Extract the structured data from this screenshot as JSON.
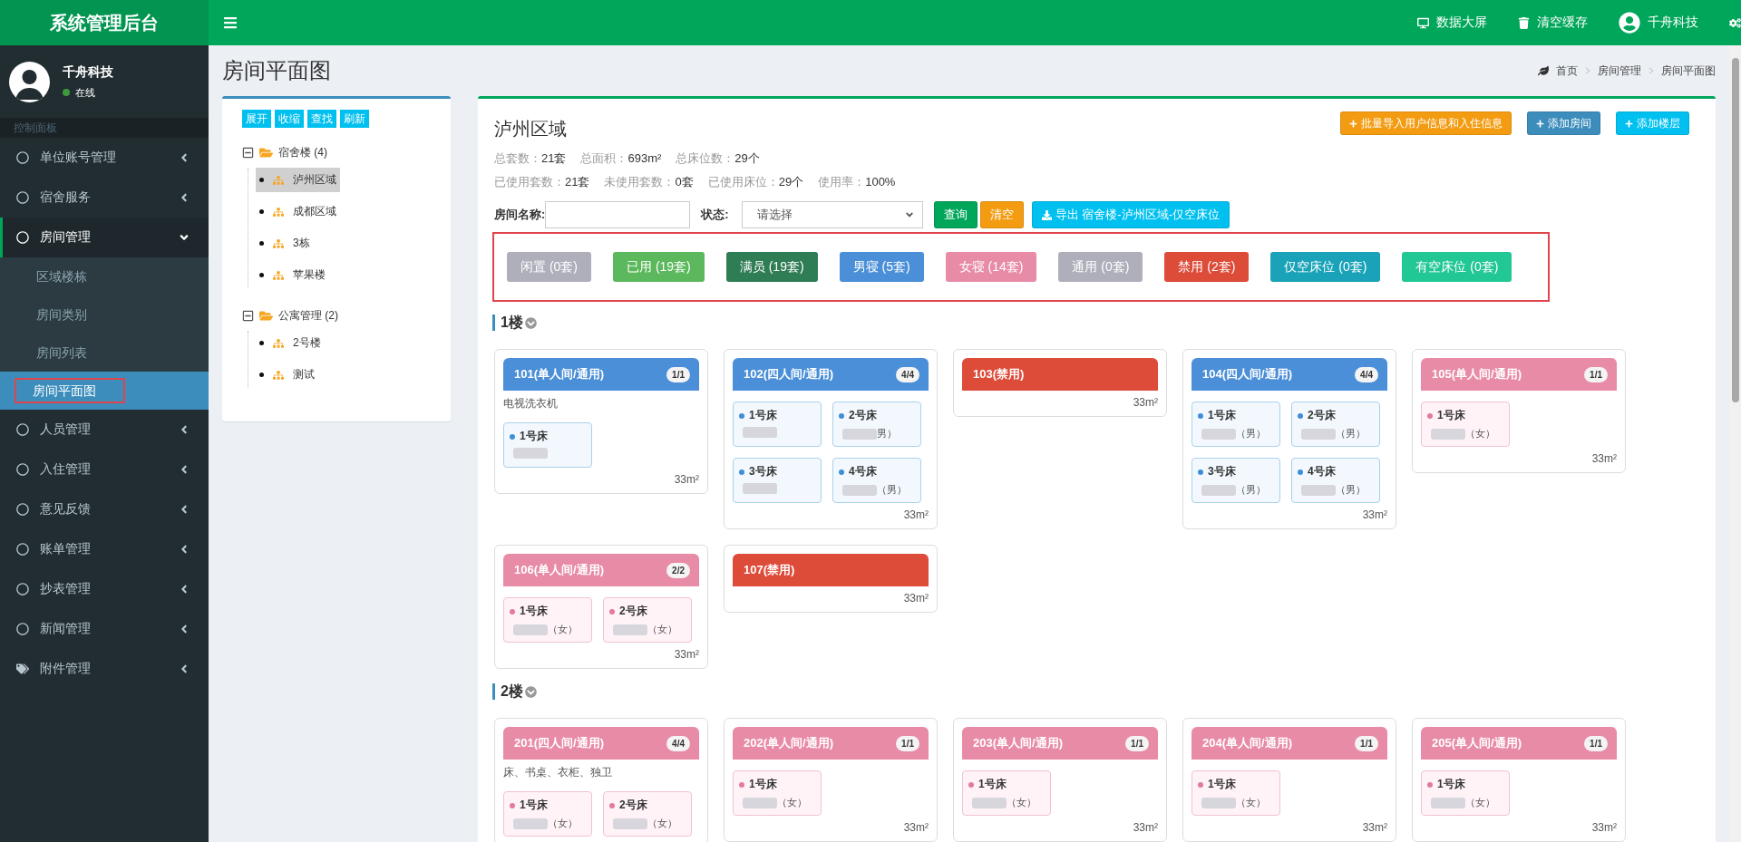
{
  "app_title": "系统管理后台",
  "header_actions": [
    {
      "kind": "monitor",
      "label": "数据大屏"
    },
    {
      "kind": "trash",
      "label": "清空缓存"
    },
    {
      "kind": "user",
      "label": "千舟科技"
    },
    {
      "kind": "gears"
    }
  ],
  "user": {
    "name": "千舟科技",
    "status": "在线"
  },
  "sidebar": {
    "section": "控制面板",
    "items": [
      {
        "label": "单位账号管理",
        "kind": "module",
        "expanded": false
      },
      {
        "label": "宿舍服务",
        "kind": "module",
        "expanded": false
      },
      {
        "label": "房间管理",
        "kind": "module",
        "expanded": true,
        "children": [
          {
            "label": "区域楼栋",
            "selected": false
          },
          {
            "label": "房间类别",
            "selected": false
          },
          {
            "label": "房间列表",
            "selected": false
          },
          {
            "label": "房间平面图",
            "selected": true
          }
        ]
      },
      {
        "label": "人员管理",
        "kind": "module",
        "expanded": false
      },
      {
        "label": "入住管理",
        "kind": "module",
        "expanded": false
      },
      {
        "label": "意见反馈",
        "kind": "module",
        "expanded": false
      },
      {
        "label": "账单管理",
        "kind": "module",
        "expanded": false
      },
      {
        "label": "抄表管理",
        "kind": "module",
        "expanded": false
      },
      {
        "label": "新闻管理",
        "kind": "module",
        "expanded": false
      },
      {
        "label": "附件管理",
        "kind": "attachment",
        "expanded": false
      }
    ]
  },
  "page_title": "房间平面图",
  "breadcrumb": [
    "首页",
    "房间管理",
    "房间平面图"
  ],
  "tree": {
    "buttons": [
      "展开",
      "收缩",
      "查找",
      "刷新"
    ],
    "groups": [
      {
        "label": "宿舍楼 (4)",
        "expanded": true,
        "children": [
          {
            "label": "泸州区域",
            "selected": true
          },
          {
            "label": "成都区域",
            "selected": false
          },
          {
            "label": "3栋",
            "selected": false
          },
          {
            "label": "苹果楼",
            "selected": false
          }
        ]
      },
      {
        "label": "公寓管理 (2)",
        "expanded": true,
        "children": [
          {
            "label": "2号楼",
            "selected": false
          },
          {
            "label": "测试",
            "selected": false
          }
        ]
      }
    ]
  },
  "region": {
    "title": "泸州区域",
    "actions": [
      {
        "kind": "warning",
        "label": "批量导入用户信息和入住信息"
      },
      {
        "kind": "primary",
        "label": "添加房间"
      },
      {
        "kind": "info",
        "label": "添加楼层"
      }
    ],
    "stats": [
      [
        {
          "label": "总套数：",
          "value": "21套"
        },
        {
          "label": "总面积：",
          "value": "693m²"
        },
        {
          "label": "总床位数：",
          "value": "29个"
        }
      ],
      [
        {
          "label": "已使用套数：",
          "value": "21套"
        },
        {
          "label": "未使用套数：",
          "value": "0套"
        },
        {
          "label": "已使用床位：",
          "value": "29个"
        },
        {
          "label": "使用率：",
          "value": "100%"
        }
      ]
    ]
  },
  "filter": {
    "name_label": "房间名称:",
    "status_label": "状态:",
    "status_value": "请选择",
    "buttons": [
      {
        "kind": "success",
        "label": "查询"
      },
      {
        "kind": "warning",
        "label": "清空"
      },
      {
        "kind": "export",
        "label": "导出 宿舍楼-泸州区域-仅空床位"
      }
    ]
  },
  "status_buttons": [
    {
      "label": "闲置 (0套)",
      "color": "#aeafbb"
    },
    {
      "label": "已用 (19套)",
      "color": "#5cb85c"
    },
    {
      "label": "满员 (19套)",
      "color": "#2f7d55"
    },
    {
      "label": "男寝 (5套)",
      "color": "#4a8fd8"
    },
    {
      "label": "女寝 (14套)",
      "color": "#e88ba6"
    },
    {
      "label": "通用 (0套)",
      "color": "#aeafbb"
    },
    {
      "label": "禁用 (2套)",
      "color": "#dd4b39"
    },
    {
      "label": "仅空床位 (0套)",
      "color": "#1aa3b8"
    },
    {
      "label": "有空床位 (0套)",
      "color": "#22c796"
    }
  ],
  "floors": [
    {
      "label": "1楼",
      "expanded": true,
      "rooms": [
        {
          "title": "101(单人间/通用)",
          "kind": "male",
          "occupancy": "1/1",
          "note": "电视洗衣机",
          "beds": [
            {
              "label": "1号床"
            }
          ],
          "area": "33m²"
        },
        {
          "title": "102(四人间/通用)",
          "kind": "male",
          "occupancy": "4/4",
          "beds": [
            {
              "label": "1号床"
            },
            {
              "label": "2号床",
              "gender": "男）"
            },
            {
              "label": "3号床"
            },
            {
              "label": "4号床",
              "gender": "（男）"
            }
          ],
          "area": "33m²"
        },
        {
          "title": "103(禁用)",
          "kind": "disabled",
          "area": "33m²"
        },
        {
          "title": "104(四人间/通用)",
          "kind": "male",
          "occupancy": "4/4",
          "beds": [
            {
              "label": "1号床",
              "gender": "（男）"
            },
            {
              "label": "2号床",
              "gender": "（男）"
            },
            {
              "label": "3号床",
              "gender": "（男）"
            },
            {
              "label": "4号床",
              "gender": "（男）"
            }
          ],
          "area": "33m²"
        },
        {
          "title": "105(单人间/通用)",
          "kind": "female",
          "occupancy": "1/1",
          "beds": [
            {
              "label": "1号床",
              "gender": "（女）"
            }
          ],
          "area": "33m²"
        },
        {
          "title": "106(单人间/通用)",
          "kind": "female",
          "occupancy": "2/2",
          "beds": [
            {
              "label": "1号床",
              "gender": "（女）"
            },
            {
              "label": "2号床",
              "gender": "（女）"
            }
          ],
          "area": "33m²"
        },
        {
          "title": "107(禁用)",
          "kind": "disabled",
          "area": "33m²"
        }
      ]
    },
    {
      "label": "2楼",
      "expanded": true,
      "rooms": [
        {
          "title": "201(四人间/通用)",
          "kind": "female",
          "occupancy": "4/4",
          "note": "床、书桌、衣柜、独卫",
          "beds": [
            {
              "label": "1号床",
              "gender": "（女）"
            },
            {
              "label": "2号床",
              "gender": "（女）"
            }
          ]
        },
        {
          "title": "202(单人间/通用)",
          "kind": "female",
          "occupancy": "1/1",
          "beds": [
            {
              "label": "1号床",
              "gender": "（女）"
            }
          ],
          "area": "33m²"
        },
        {
          "title": "203(单人间/通用)",
          "kind": "female",
          "occupancy": "1/1",
          "beds": [
            {
              "label": "1号床",
              "gender": "（女）"
            }
          ],
          "area": "33m²"
        },
        {
          "title": "204(单人间/通用)",
          "kind": "female",
          "occupancy": "1/1",
          "beds": [
            {
              "label": "1号床",
              "gender": "（女）"
            }
          ],
          "area": "33m²"
        },
        {
          "title": "205(单人间/通用)",
          "kind": "female",
          "occupancy": "1/1",
          "beds": [
            {
              "label": "1号床",
              "gender": "（女）"
            }
          ],
          "area": "33m²"
        }
      ]
    }
  ]
}
